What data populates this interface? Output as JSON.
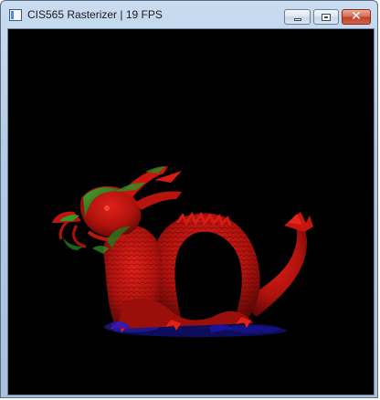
{
  "window": {
    "title": "CIS565 Rasterizer | 19 FPS",
    "icon": "app-window-icon",
    "controls": {
      "minimize_icon": "minimize-icon",
      "maximize_icon": "maximize-icon",
      "close_icon": "close-icon",
      "close_glyph": "✕"
    }
  },
  "viewport": {
    "background": "#000000",
    "subject": "dragon-model",
    "colors": {
      "primary": "#c0140f",
      "highlight": "#23a01e",
      "shadow": "#1a16a8"
    }
  }
}
